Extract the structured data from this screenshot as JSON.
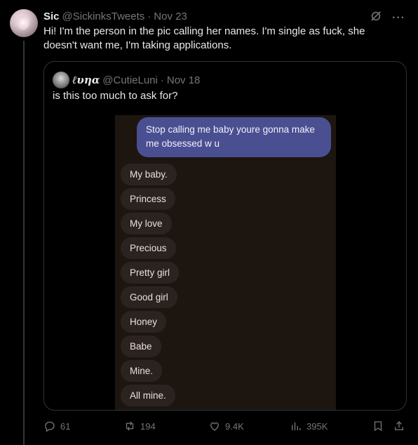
{
  "tweet": {
    "name": "Sic",
    "handle": "@SickinksTweets",
    "separator": "·",
    "time": "Nov 23",
    "text": "Hi! I'm the person in the pic calling her names. I'm single as fuck, she doesn't want me, I'm taking applications.",
    "more_label": "···"
  },
  "quote": {
    "name": "ℓυηα",
    "handle": "@CutieLuni",
    "separator": "·",
    "time": "Nov 18",
    "text": "is this too much to ask for?",
    "chat": {
      "sent": "Stop calling me baby youre gonna make me obsessed w u",
      "received": [
        "My baby.",
        "Princess",
        "My love",
        "Precious",
        "Pretty girl",
        "Good girl",
        "Honey",
        "Babe",
        "Mine.",
        "All mine."
      ]
    }
  },
  "actions": {
    "replies": "61",
    "reposts": "194",
    "likes": "9.4K",
    "views": "395K"
  },
  "colors": {
    "background": "#000000",
    "text": "#e7e9ea",
    "muted": "#71767b",
    "sent_bubble": "#4a4f92",
    "received_bubble": "#2b2320"
  },
  "icons": [
    "grok-icon",
    "more-icon",
    "reply-icon",
    "repost-icon",
    "like-icon",
    "views-icon",
    "bookmark-icon",
    "share-icon"
  ]
}
